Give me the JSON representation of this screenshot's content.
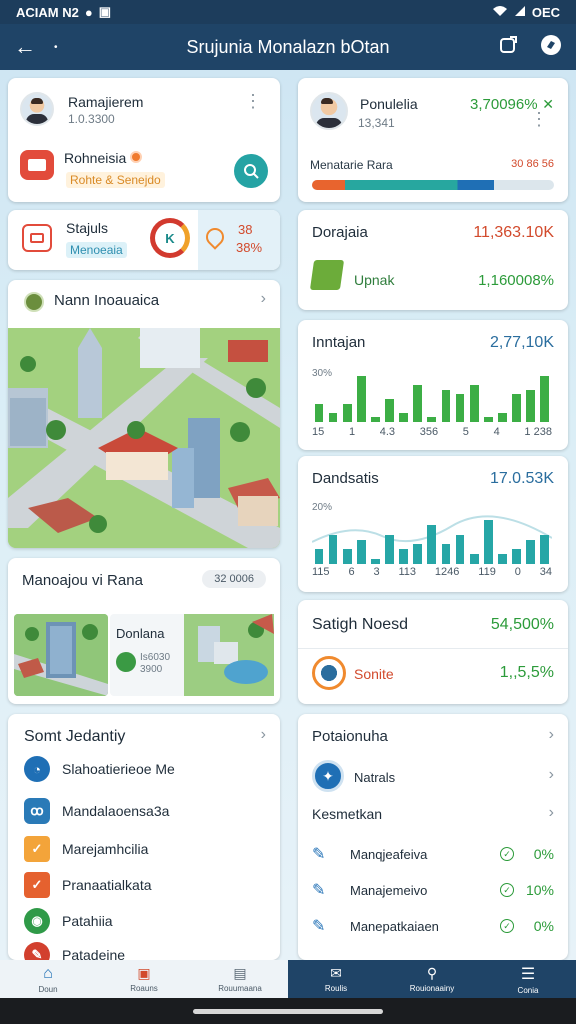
{
  "status_bar": {
    "time": "ACIAM N2",
    "battery": "OEC"
  },
  "app_bar": {
    "title": "Srujunia Monalazn bOtan"
  },
  "left": {
    "profile": {
      "name": "Ramajierem",
      "sub": "1.0.3300"
    },
    "notif": {
      "label": "Rohneisia",
      "tag": "Rohte & Senejdo"
    },
    "status": {
      "label": "Stajuls",
      "tag": "Menoeaia",
      "value": "38",
      "percent": "38%"
    },
    "map": {
      "title": "Nann Inoauaica"
    },
    "manage": {
      "title": "Manoajou vi Rana",
      "badge": "32 0006",
      "cap_title": "Donlana",
      "cap_sub1": "Is6030",
      "cap_sub2": "3900"
    },
    "security": {
      "title": "Somt Jedantiy",
      "items": [
        {
          "label": "Slahoatierieoe Me"
        },
        {
          "label": "Mandalaoensa3a"
        },
        {
          "label": "Marejamhcilia"
        },
        {
          "label": "Pranaatialkata"
        },
        {
          "label": "Patahiia"
        },
        {
          "label": "Patadeine"
        }
      ]
    }
  },
  "right": {
    "profile": {
      "name": "Ponulelia",
      "sub": "13,341",
      "value": "3,70096%",
      "progress_label": "Menatarie Rara",
      "progress_value": "30 86 56",
      "progress_fraction": 0.75
    },
    "card2": {
      "title": "Dorajaia",
      "value": "11,363.10K",
      "sub_label": "Upnak",
      "sub_value": "1,160008%"
    },
    "chart1": {
      "title": "Inntajan",
      "value": "2,77,10K",
      "ylabel": "30%",
      "ticks": [
        "15",
        "1",
        "4.3",
        "356",
        "5",
        "4",
        "1 238"
      ]
    },
    "chart2": {
      "title": "Dandsatis",
      "value": "17.0.53K",
      "ylabel": "20%",
      "ticks": [
        "115",
        "6",
        "3",
        "113",
        "1246",
        "119",
        "0",
        "34"
      ]
    },
    "card5": {
      "title": "Satigh Noesd",
      "value": "54,500%",
      "sub_label": "Sonite",
      "sub_value": "1,,5,5%"
    },
    "card6": {
      "title": "Potaionuha",
      "item1": "Natrals",
      "item2": "Kesmetkan",
      "rows": [
        {
          "label": "Manqjeafeiva",
          "pct": "0%"
        },
        {
          "label": "Manajemeivo",
          "pct": "10%"
        },
        {
          "label": "Manepatkaiaen",
          "pct": "0%"
        }
      ]
    }
  },
  "chart_data": [
    {
      "type": "bar",
      "title": "Inntajan",
      "ylabel": "30%",
      "categories": [
        "15",
        "1",
        "4.3",
        "356",
        "5",
        "4",
        "1 238"
      ],
      "values": [
        4,
        2,
        4,
        10,
        1,
        5,
        2,
        8,
        1,
        7,
        6,
        8,
        1,
        2,
        6,
        7,
        10
      ]
    },
    {
      "type": "bar",
      "title": "Dandsatis",
      "ylabel": "20%",
      "categories": [
        "115",
        "6",
        "3",
        "113",
        "1246",
        "119",
        "0",
        "34"
      ],
      "values": [
        3,
        6,
        3,
        5,
        1,
        6,
        3,
        4,
        8,
        4,
        6,
        2,
        9,
        2,
        3,
        5,
        6
      ]
    }
  ],
  "nav": {
    "items": [
      {
        "label": "Doun"
      },
      {
        "label": "Roauns"
      },
      {
        "label": "Rouumaana"
      },
      {
        "label": "Roulis"
      },
      {
        "label": "Rouionaainy"
      },
      {
        "label": "Conia"
      }
    ]
  },
  "colors": {
    "appbar": "#1f4467",
    "accent_green": "#2c9b3a",
    "accent_red": "#d24a2c",
    "chart_teal": "#26a6a6",
    "chart_green": "#3cae45"
  }
}
